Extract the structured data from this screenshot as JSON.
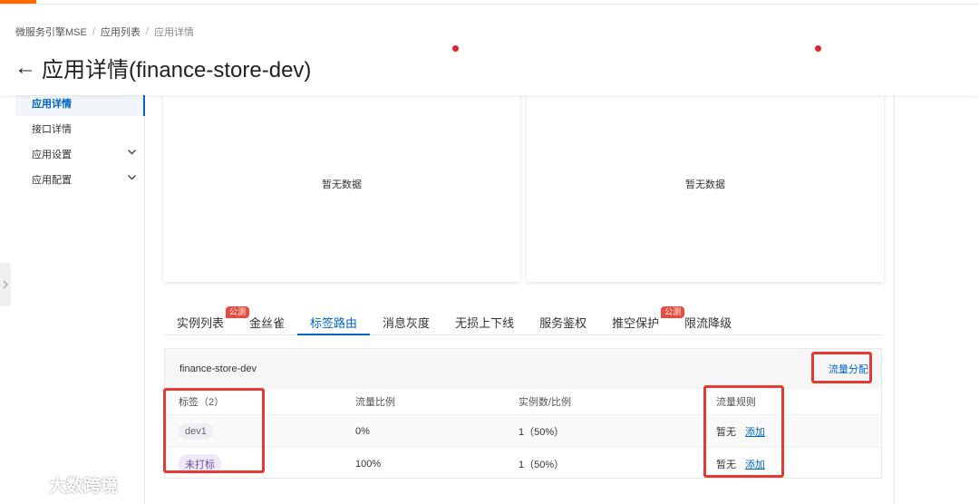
{
  "breadcrumb": {
    "items": [
      "微服务引擎MSE",
      "应用列表",
      "应用详情"
    ],
    "separator": "/"
  },
  "page": {
    "title": "应用详情(finance-store-dev)",
    "back_glyph": "←"
  },
  "sidebar": {
    "items": [
      {
        "label": "应用详情",
        "active": true,
        "expandable": false
      },
      {
        "label": "接口详情",
        "active": false,
        "expandable": false
      },
      {
        "label": "应用设置",
        "active": false,
        "expandable": true
      },
      {
        "label": "应用配置",
        "active": false,
        "expandable": true
      }
    ],
    "chevron_glyph": "⌄"
  },
  "cards": [
    {
      "empty_text": "暂无数据"
    },
    {
      "empty_text": "暂无数据"
    }
  ],
  "tabs": [
    {
      "label": "实例列表",
      "badge": "公测",
      "active": false
    },
    {
      "label": "金丝雀",
      "badge": "",
      "active": false
    },
    {
      "label": "标签路由",
      "badge": "",
      "active": true
    },
    {
      "label": "消息灰度",
      "badge": "",
      "active": false
    },
    {
      "label": "无损上下线",
      "badge": "",
      "active": false
    },
    {
      "label": "服务鉴权",
      "badge": "",
      "active": false
    },
    {
      "label": "推空保护",
      "badge": "公测",
      "active": false
    },
    {
      "label": "限流降级",
      "badge": "",
      "active": false
    }
  ],
  "routing": {
    "app_name": "finance-store-dev",
    "flow_link": "流量分配",
    "columns": [
      "标签（2）",
      "流量比例",
      "实例数/比例",
      "流量规则"
    ],
    "rows": [
      {
        "tag": "dev1",
        "ratio": "0%",
        "instances": "1（50%）",
        "rule": "暂无",
        "action": "添加"
      },
      {
        "tag": "未打标",
        "ratio": "100%",
        "instances": "1（50%）",
        "rule": "暂无",
        "action": "添加"
      }
    ]
  },
  "watermark": {
    "text": "大数跨境"
  },
  "colors": {
    "accent": "#0064c8",
    "highlight": "#e53935",
    "badge": "#e84c3d",
    "brand": "#ff6a00"
  }
}
